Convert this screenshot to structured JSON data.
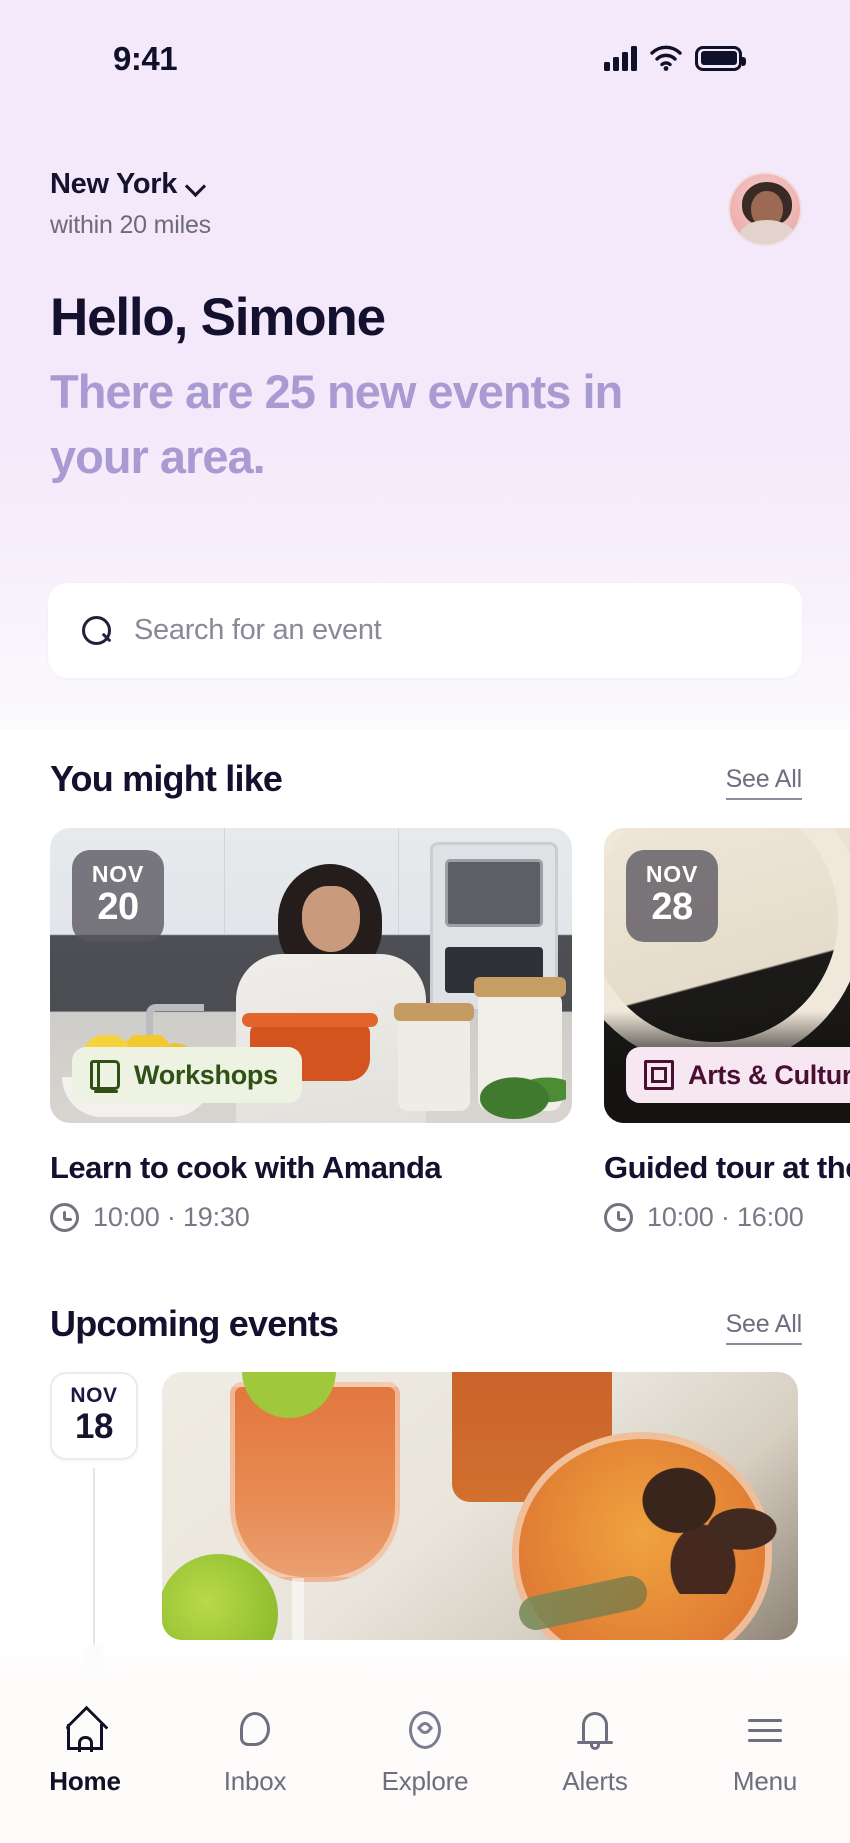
{
  "status_bar": {
    "time": "9:41",
    "signal_icon": "cellular-signal-icon",
    "wifi_icon": "wifi-icon",
    "battery_icon": "battery-icon"
  },
  "header": {
    "location": "New York",
    "location_chevron_icon": "chevron-down-icon",
    "radius": "within 20 miles",
    "avatar_alt": "user-avatar"
  },
  "greeting": {
    "title": "Hello, Simone",
    "subtitle": "There are 25 new events in your area.",
    "new_event_count": 25
  },
  "search": {
    "placeholder": "Search for an event",
    "value": "",
    "icon": "search-icon"
  },
  "sections": [
    {
      "id": "you-might-like",
      "title": "You might like",
      "see_all_label": "See All"
    },
    {
      "id": "upcoming-events",
      "title": "Upcoming events",
      "see_all_label": "See All"
    }
  ],
  "recommended_cards": [
    {
      "month": "NOV",
      "day": "20",
      "category": "Workshops",
      "category_icon": "book-icon",
      "title": "Learn to cook with Amanda",
      "time": "10:00 · 19:30",
      "clock_icon": "clock-icon",
      "image_alt": "woman-cooking-in-kitchen"
    },
    {
      "month": "NOV",
      "day": "28",
      "category": "Arts & Culture",
      "category_icon": "picture-frame-icon",
      "title": "Guided tour at the",
      "time": "10:00 · 16:00",
      "clock_icon": "clock-icon",
      "image_alt": "marble-statue-in-museum"
    }
  ],
  "upcoming_events": [
    {
      "month": "NOV",
      "day": "18",
      "image_alt": "cocktails-with-lime-and-figs"
    }
  ],
  "bottom_nav": {
    "items": [
      {
        "label": "Home",
        "icon": "home-icon",
        "active": true
      },
      {
        "label": "Inbox",
        "icon": "chat-bubble-icon",
        "active": false
      },
      {
        "label": "Explore",
        "icon": "compass-icon",
        "active": false
      },
      {
        "label": "Alerts",
        "icon": "bell-icon",
        "active": false
      },
      {
        "label": "Menu",
        "icon": "hamburger-menu-icon",
        "active": false
      }
    ]
  },
  "colors": {
    "hero_background": "#f4e9fb",
    "text_dark": "#14112f",
    "accent_lavender": "#a79bd2",
    "muted_text": "#6f6d7e",
    "workshops_chip_bg": "#eef2e3",
    "workshops_chip_text": "#2f5116",
    "arts_chip_bg": "#f7e7f0",
    "arts_chip_text": "#4a1034"
  }
}
